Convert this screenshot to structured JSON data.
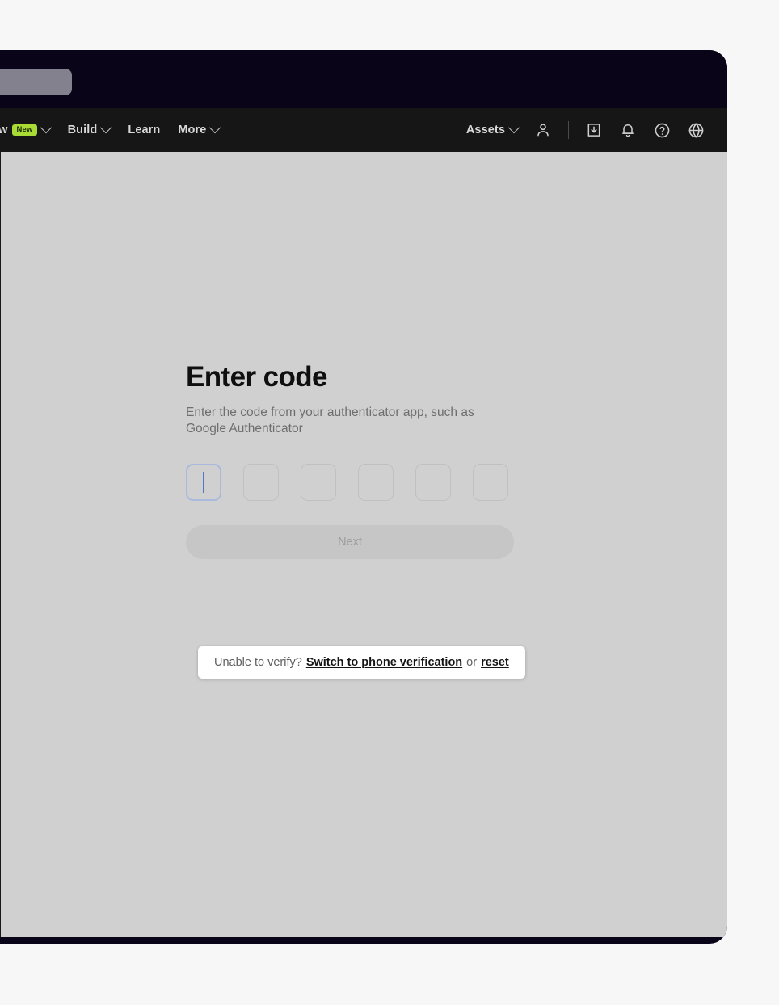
{
  "window": {
    "tab_label": ""
  },
  "nav": {
    "left_items": [
      {
        "label": "Grow",
        "badge": "New",
        "has_caret": true
      },
      {
        "label": "Build",
        "badge": "",
        "has_caret": true
      },
      {
        "label": "Learn",
        "badge": "",
        "has_caret": false
      },
      {
        "label": "More",
        "badge": "",
        "has_caret": true
      }
    ],
    "assets": {
      "label": "Assets",
      "has_caret": true
    },
    "icons": [
      "account-icon",
      "download-icon",
      "notifications-bell-icon",
      "help-icon",
      "language-globe-icon"
    ]
  },
  "main": {
    "title": "Enter code",
    "subtitle": "Enter the code from your authenticator app, such as Google Authenticator",
    "code_input": {
      "length": 6,
      "values": [
        "",
        "",
        "",
        "",
        "",
        ""
      ],
      "focused_index": 0
    },
    "next_button": {
      "label": "Next",
      "disabled": true
    }
  },
  "verify_bar": {
    "prefix": "Unable to verify?",
    "switch_link": "Switch to phone verification",
    "conjunction": "or",
    "reset_link": "reset"
  },
  "colors": {
    "window_chrome": "#0a0419",
    "nav_background": "#161616",
    "content_background": "#d0d0d0",
    "badge_new": "#a8db33",
    "focus_border": "#a9bade",
    "caret": "#4f78c4",
    "page_background": "#f7f7f8"
  }
}
